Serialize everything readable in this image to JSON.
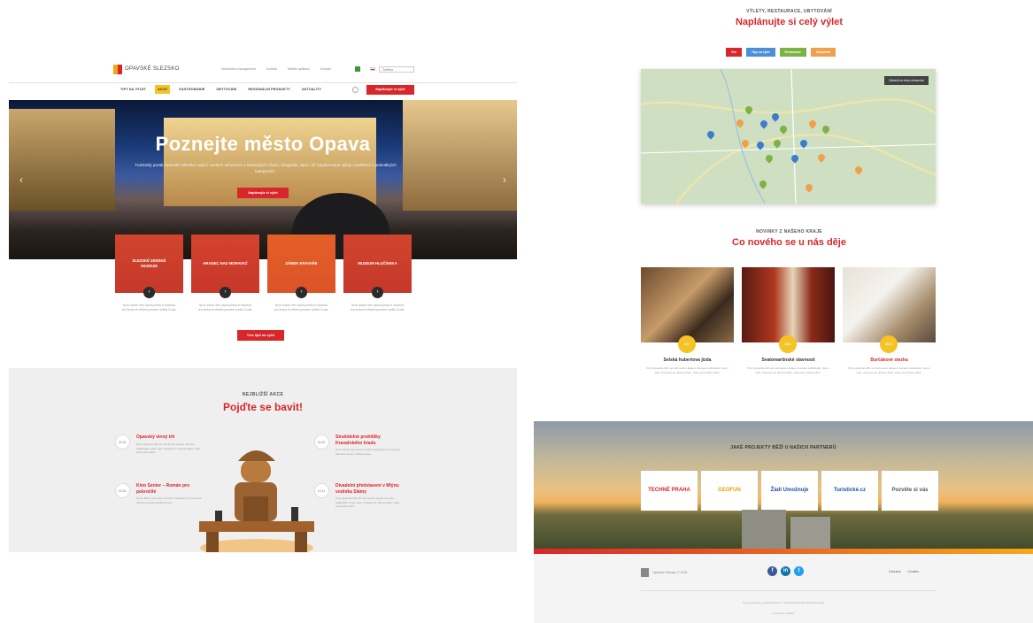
{
  "left": {
    "brand": "OPAVSKÉ SLEZSKO",
    "top_links": [
      "Destination management",
      "Kontakt",
      "Mobilní aplikace",
      "Kontakt"
    ],
    "lang": "Čeština",
    "nav": [
      "TIPY NA VÝLET",
      "AKCE",
      "GASTRONOMIE",
      "UBYTOVÁNÍ",
      "REGIONÁLNÍ PRODUKTY",
      "AKTUALITY"
    ],
    "nav_active": 1,
    "nav_button": "Naplánujte si výlet",
    "hero": {
      "title": "Poznejte město Opava",
      "text": "Turistický portál Opavské Slezsko nabízí ucelené informace o turistických cílech, fotografie, akce i již naplánované výlety rozdělené v jednotlivých kategoriích.",
      "button": "Naplánujte si výlet"
    },
    "cards": [
      {
        "title": "SLEZSKÉ ZEMSKÉ MUZEUM",
        "text": "Nunc dolore vero ipsum primis in faucibus orci luctus et ultrices posuere cubilia Curae."
      },
      {
        "title": "HRADEC NAD MORAVICÍ",
        "text": "Nunc dolore vero ipsum primis in faucibus orci luctus et ultrices posuere cubilia Curae."
      },
      {
        "title": "ZÁMEK KRAVAŘE",
        "text": "Nunc dolore vero ipsum primis in faucibus orci luctus et ultrices posuere cubilia Curae."
      },
      {
        "title": "MUZEUM HLUČÍNSKA",
        "text": "Nunc dolore vero ipsum primis in faucibus orci luctus et ultrices posuere cubilia Curae."
      }
    ],
    "all_button": "Více tipů na výlet",
    "events": {
      "kicker": "NEJBLIŽŠÍ AKCE",
      "title": "Pojďte se bavit!",
      "items": [
        {
          "date": "22.10.",
          "title": "Opavský vinný trh",
          "text": "Proin gravida nibh vel velit auctor aliquet. Aenean sollicitudin, lorem quis. Vivamus ac ultrices diam, vitae accumsan tellus."
        },
        {
          "date": "18.10.",
          "title": "Kino Senior – Román pro pokročilé",
          "text": "Nunc dolore vero ipsum primis in faucibus orci luctus et ultrices posuere cubilia Curae."
        },
        {
          "date": "26.10.",
          "title": "Strašidelné prohlídky Kravařského hradu",
          "text": "Nunc dolore vero ipsum primis in faucibus orci luctus et ultrices posuere cubilia Curae."
        },
        {
          "date": "10.11.",
          "title": "Divadelní představení v Mlýnu vodníka Slámy",
          "text": "Proin gravida nibh vel velit auctor aliquet. Aenean sollicitudin, lorem quis. Vivamus ac ultrices diam, vitae accumsan tellus."
        }
      ]
    }
  },
  "right": {
    "kicker": "VÝLETY, RESTAURACE, UBYTOVÁNÍ",
    "title": "Naplánujte si celý výlet",
    "tabs": [
      {
        "label": "Vše",
        "color": "#d9262a"
      },
      {
        "label": "Tipy na výlet",
        "color": "#4a90d9"
      },
      {
        "label": "Restaurace",
        "color": "#7cb342"
      },
      {
        "label": "Ubytování",
        "color": "#f0a04b"
      }
    ],
    "map_button": "Zobrazit na celou obrazovku",
    "news": {
      "kicker": "NOVINKY Z NAŠEHO KRAJE",
      "title": "Co nového se u nás děje",
      "items": [
        {
          "date": "3.5.",
          "title": "Selská hubertova jízda",
          "text": "Proin gravida nibh vel velit auctor aliquet. Aenean sollicitudin, lorem quis. Vivamus ac ultrices diam, vitae accumsan tellus."
        },
        {
          "date": "12.5.",
          "title": "Svatomartinské slavnosti",
          "text": "Proin gravida nibh vel velit auctor aliquet. Aenean sollicitudin, lorem quis. Vivamus ac ultrices diam, vitae accumsan tellus."
        },
        {
          "date": "20.5.",
          "title": "Burčákové stezka",
          "text": "Proin gravida nibh vel velit auctor aliquet. Aenean sollicitudin, lorem quis. Vivamus ac ultrices diam, vitae accumsan tellus."
        }
      ]
    },
    "partners": {
      "kicker": "JAKÉ PROJEKTY BĚŽÍ U NAŠICH PARTNERŮ",
      "logos": [
        "TECHNÉ PRAHA",
        "GEOFUN",
        "Žádí Umožnuje",
        "Turistické.cz",
        "Pozvěte si vás"
      ]
    },
    "footer": {
      "copyright": "Opavské Slezsko © 2016",
      "links": [
        "Ochrana",
        "Cookies"
      ],
      "note": "Tento projekt je spolufinancován z rozpočtu Moravskoslezského kraje",
      "credit": "Created by: Webdo"
    }
  }
}
